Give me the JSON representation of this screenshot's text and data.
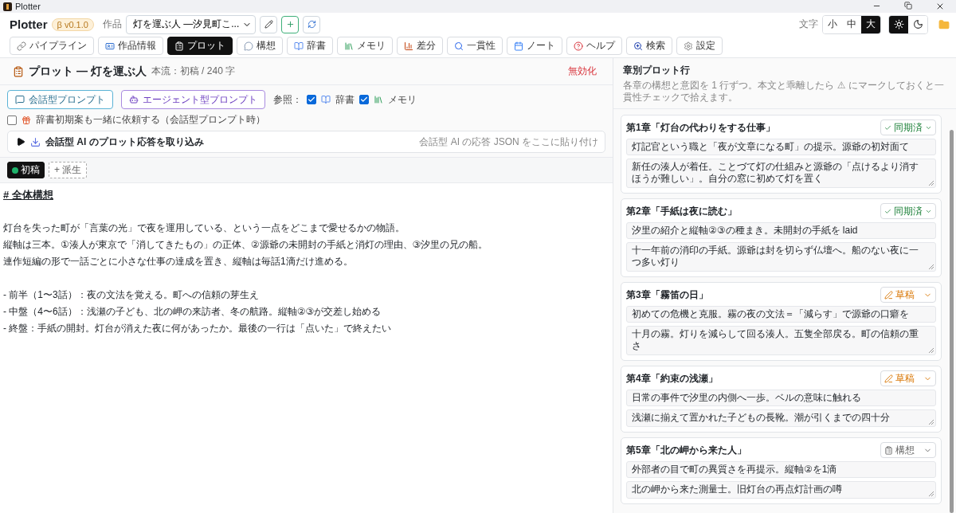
{
  "window": {
    "title": "Plotter"
  },
  "header": {
    "app_name": "Plotter",
    "version": "β v0.1.0",
    "work_label": "作品",
    "work_select": "灯を運ぶ人 ―汐見町こ...",
    "nav": [
      {
        "label": "パイプライン",
        "selected": false
      },
      {
        "label": "作品情報",
        "selected": false
      },
      {
        "label": "プロット",
        "selected": true
      },
      {
        "label": "構想",
        "selected": false
      },
      {
        "label": "辞書",
        "selected": false
      },
      {
        "label": "メモリ",
        "selected": false
      },
      {
        "label": "差分",
        "selected": false
      },
      {
        "label": "一貫性",
        "selected": false
      },
      {
        "label": "ノート",
        "selected": false
      },
      {
        "label": "ヘルプ",
        "selected": false
      },
      {
        "label": "検索",
        "selected": false
      },
      {
        "label": "設定",
        "selected": false
      }
    ],
    "font_size": {
      "label": "文字",
      "options": [
        {
          "label": "小",
          "selected": false
        },
        {
          "label": "中",
          "selected": false
        },
        {
          "label": "大",
          "selected": true
        }
      ]
    },
    "theme": [
      {
        "kind": "light",
        "selected": true
      },
      {
        "kind": "dark",
        "selected": false
      }
    ]
  },
  "plot": {
    "title": "プロット — 灯を運ぶ人",
    "meta": "本流：初稿 / 240 字",
    "disable": "無効化",
    "prompt_buttons": [
      "会話型プロンプト",
      "エージェント型プロンプト"
    ],
    "refs_label": "参照：",
    "refs": [
      {
        "label": "辞書",
        "checked": true
      },
      {
        "label": "メモリ",
        "checked": true
      }
    ],
    "dict_option": {
      "label": "辞書初期案も一緒に依頼する（会話型プロンプト時）",
      "checked": false
    },
    "import": {
      "title": "会話型 AI のプロット応答を取り込み",
      "placeholder": "会話型 AI の応答 JSON をここに貼り付け",
      "expanded": false
    },
    "branches": [
      {
        "label": "初稿",
        "selected": true
      }
    ],
    "add_branch": "+ 派生",
    "body": [
      {
        "kind": "heading",
        "text": "# 全体構想"
      },
      {
        "kind": "paragraph",
        "lines": [
          "灯台を失った町が「言葉の光」で夜を運用している、という一点をどこまで愛せるかの物語。",
          "縦軸は三本。①湊人が東京で「消してきたもの」の正体、②源爺の未開封の手紙と消灯の理由、③汐里の兄の船。",
          "連作短編の形で一話ごとに小さな仕事の達成を置き、縦軸は毎話1滴だけ進める。"
        ]
      },
      {
        "kind": "paragraph",
        "lines": [
          "- 前半（1〜3話）：夜の文法を覚える。町への信頼の芽生え",
          "- 中盤（4〜6話）：浅瀬の子ども、北の岬の来訪者、冬の航路。縦軸②③が交差し始める",
          "- 終盤：手紙の開封。灯台が消えた夜に何があったか。最後の一行は「点いた」で終えたい"
        ]
      }
    ]
  },
  "chapters": {
    "title": "章別プロット行",
    "description": "各章の構想と意図を 1 行ずつ。本文と乖離したら ⚠ にマークしておくと一貫性チェックで拾えます。",
    "items": [
      {
        "title": "第1章「灯台の代わりをする仕事」",
        "status": {
          "kind": "synced",
          "label": "同期済"
        },
        "summary": "灯記官という職と「夜が文章になる町」の提示。源爺の初対面て",
        "note": "新任の湊人が着任。ことづて灯の仕組みと源爺の「点けるより消すほうが難しい」。自分の窓に初めて灯を置く"
      },
      {
        "title": "第2章「手紙は夜に読む」",
        "status": {
          "kind": "synced",
          "label": "同期済"
        },
        "summary": "汐里の紹介と縦軸②③の種まき。未開封の手紙を laid",
        "note": "十一年前の消印の手紙。源爺は封を切らず仏壇へ。船のない夜に一つ多い灯り"
      },
      {
        "title": "第3章「霧笛の日」",
        "status": {
          "kind": "draft",
          "label": "草稿"
        },
        "summary": "初めての危機と克服。霧の夜の文法＝「減らす」で源爺の口癖を",
        "note": "十月の霧。灯りを減らして回る湊人。五隻全部戻る。町の信頼の重さ"
      },
      {
        "title": "第4章「約束の浅瀬」",
        "status": {
          "kind": "draft",
          "label": "草稿"
        },
        "summary": "日常の事件で汐里の内側へ一歩。ベルの意味に触れる",
        "note": "浅瀬に揃えて置かれた子どもの長靴。潮が引くまでの四十分"
      },
      {
        "title": "第5章「北の岬から来た人」",
        "status": {
          "kind": "idea",
          "label": "構想"
        },
        "summary": "外部者の目で町の異質さを再提示。縦軸②を1滴",
        "note": "北の岬から来た測量士。旧灯台の再点灯計画の噂"
      }
    ]
  }
}
